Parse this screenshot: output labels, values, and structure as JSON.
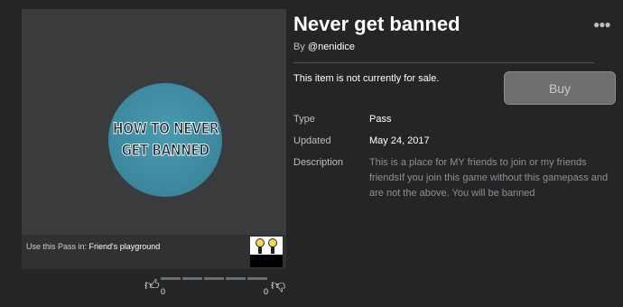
{
  "item": {
    "title": "Never get banned",
    "creator_prefix": "By ",
    "creator_name": "@nenidice",
    "sale_status": "This item is not currently for sale.",
    "buy_label": "Buy",
    "more_icon": "ellipsis-icon"
  },
  "badge": {
    "line1": "HOW TO NEVER",
    "line2": "GET BANNED"
  },
  "usage": {
    "prefix": "Use this Pass in: ",
    "game_name": "Friend's playground"
  },
  "details": {
    "type_label": "Type",
    "type_value": "Pass",
    "updated_label": "Updated",
    "updated_value": "May 24, 2017",
    "description_label": "Description",
    "description_value": "This is a place for MY friends to join or my friends friendsIf you join this game without this gamepass and are not the above. You will be banned"
  },
  "votes": {
    "up_count": "0",
    "down_count": "0",
    "up_icon": "thumbs-up-icon",
    "down_icon": "thumbs-down-icon"
  }
}
